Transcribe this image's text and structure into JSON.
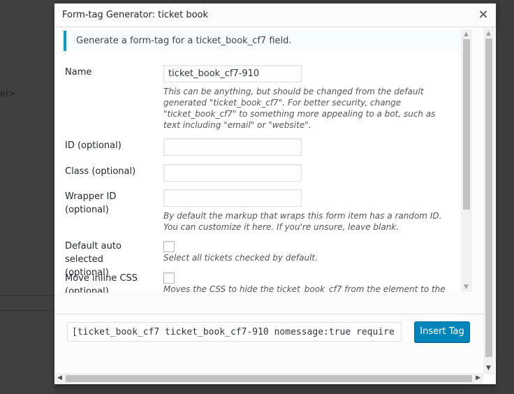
{
  "background": {
    "left_text": "el>"
  },
  "dialog": {
    "title": "Form-tag Generator: ticket book",
    "close_icon": "×",
    "notice": "Generate a form-tag for a ticket_book_cf7 field.",
    "fields": {
      "name": {
        "label": "Name",
        "value": "ticket_book_cf7-910",
        "description": "This can be anything, but should be changed from the default generated \"ticket_book_cf7\". For better security, change \"ticket_book_cf7\" to something more appealing to a bot, such as text including \"email\" or \"website\"."
      },
      "id": {
        "label": "ID (optional)",
        "value": ""
      },
      "class": {
        "label": "Class (optional)",
        "value": ""
      },
      "wrapper_id": {
        "label": "Wrapper ID (optional)",
        "value": "",
        "description": "By default the markup that wraps this form item has a random ID. You can customize it here. If you're unsure, leave blank."
      },
      "default_auto": {
        "label": "Default auto selected (optional)",
        "checked": false,
        "description": "Select all tickets checked by default."
      },
      "move_inline_css": {
        "label": "Move inline CSS (optional)",
        "checked": false,
        "description": "Moves the CSS to hide the ticket_book_cf7 from the element to the footer"
      }
    },
    "tag_value": "[ticket_book_cf7 ticket_book_cf7-910 nomessage:true require",
    "insert_button": "Insert Tag"
  },
  "icons": {
    "close": "close-icon",
    "scroll_up": "chevron-up-icon",
    "scroll_down": "chevron-down-icon",
    "scroll_left": "chevron-left-icon",
    "scroll_right": "chevron-right-icon"
  },
  "colors": {
    "accent": "#00a0d2",
    "button": "#0085ba",
    "overlay": "#3a3a3a"
  }
}
